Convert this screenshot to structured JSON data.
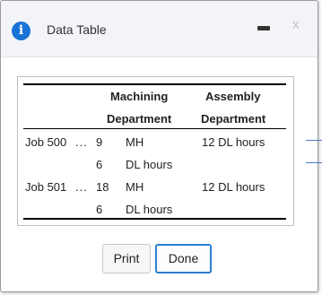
{
  "dialog": {
    "title": "Data Table",
    "info_glyph": "i",
    "close_glyph": "x"
  },
  "table": {
    "headers": {
      "machining_line1": "Machining",
      "machining_line2": "Department",
      "assembly_line1": "Assembly",
      "assembly_line2": "Department"
    },
    "rows": [
      {
        "job": "Job 500",
        "dots": "...",
        "mach_value": "9",
        "mach_unit": "MH",
        "assembly": "12 DL hours"
      },
      {
        "job": "",
        "dots": "",
        "mach_value": "6",
        "mach_unit": "DL hours",
        "assembly": ""
      },
      {
        "job": "Job 501",
        "dots": "...",
        "mach_value": "18",
        "mach_unit": "MH",
        "assembly": "12 DL hours"
      },
      {
        "job": "",
        "dots": "",
        "mach_value": "6",
        "mach_unit": "DL hours",
        "assembly": ""
      }
    ]
  },
  "buttons": {
    "print": "Print",
    "done": "Done"
  },
  "icons": {
    "info": "info-icon",
    "minimize": "minimize-icon",
    "close": "close-icon"
  },
  "colors": {
    "accent": "#1a73d6",
    "done_border": "#2c7fd0"
  }
}
